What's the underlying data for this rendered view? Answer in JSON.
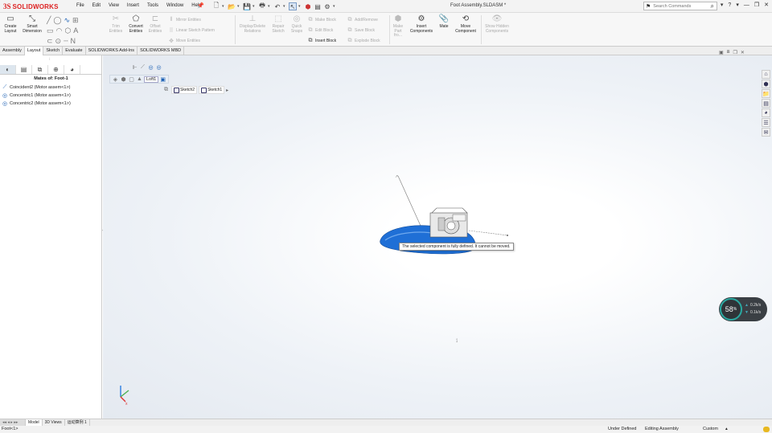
{
  "app": {
    "brand": "SOLIDWORKS",
    "doc_title": "Foot Assembly.SLDASM *",
    "menu": [
      "File",
      "Edit",
      "View",
      "Insert",
      "Tools",
      "Window",
      "Help"
    ],
    "search_placeholder": "Search Commands",
    "help_label": "?"
  },
  "command_manager": {
    "create_layout": "Create Layout",
    "smart_dimension": "Smart Dimension",
    "trim_entities": "Trim Entities",
    "convert_entities": "Convert Entities",
    "offset_entities": "Offset Entities",
    "mirror_entities": "Mirror Entities",
    "linear_sketch_pattern": "Linear Sketch Pattern",
    "move_entities": "Move Entities",
    "display_delete_relations": "Display/Delete Relations",
    "repair_sketch": "Repair Sketch",
    "quick_snaps": "Quick Snaps",
    "make_block": "Make Block",
    "edit_block": "Edit Block",
    "insert_block": "Insert Block",
    "add_remove": "Add/Remove",
    "save_block": "Save Block",
    "explode_block": "Explode Block",
    "make_part_from_block": "Make Part fro...",
    "insert_components": "Insert Components",
    "mate": "Mate",
    "move_component": "Move Component",
    "show_hidden_components": "Show Hidden Components"
  },
  "tabs": [
    "Assembly",
    "Layout",
    "Sketch",
    "Evaluate",
    "SOLIDWORKS Add-Ins",
    "SOLIDWORKS MBD"
  ],
  "active_tab": "Layout",
  "left_panel": {
    "title": "Mates of: Foot-1",
    "mates": [
      {
        "icon": "coincident-icon",
        "label": "Coincident2 (Motor assem<1>)"
      },
      {
        "icon": "concentric-icon",
        "label": "Concentric1 (Motor assem<1>)"
      },
      {
        "icon": "concentric-icon",
        "label": "Concentric2 (Motor assem<1>)"
      }
    ]
  },
  "viewport": {
    "feature_label": "Loft1",
    "sketches": [
      "Sketch2",
      "Sketch1"
    ],
    "tooltip": "The selected component is fully defined.  It cannot be moved."
  },
  "performance": {
    "percent": "58",
    "unit": "%",
    "stat1": "0.2k/s",
    "stat2": "0.1k/s"
  },
  "bottom_tabs": [
    "Model",
    "3D Views",
    "运动算例 1"
  ],
  "status": {
    "selection": "Foot<1>",
    "definition": "Under Defined",
    "mode": "Editing Assembly",
    "units": "Custom",
    "units_arrow": "▴"
  }
}
